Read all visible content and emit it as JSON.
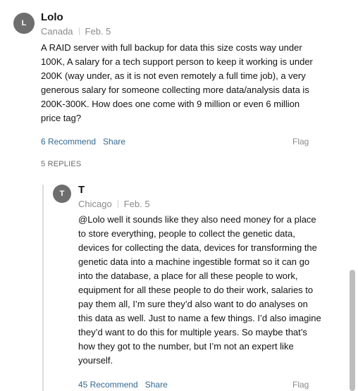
{
  "comment": {
    "avatar_letter": "L",
    "author": "Lolo",
    "location": "Canada",
    "date": "Feb. 5",
    "text": "A RAID server with full backup for data this size costs way under 100K, A salary for a tech support person to keep it working is under 200K (way under, as it is not even remotely a full time job), a very generous salary for someone collecting more data/analysis data is 200K-300K.  How does one come with 9 million or even 6 million price tag?",
    "recommend_label": "6 Recommend",
    "share_label": "Share",
    "flag_label": "Flag",
    "replies_label": "5 REPLIES"
  },
  "reply": {
    "avatar_letter": "T",
    "author": "T",
    "location": "Chicago",
    "date": "Feb. 5",
    "text": "@Lolo well it sounds like they also need money for a place to store everything, people to collect the genetic data, devices for collecting the data, devices for transforming the genetic data into a machine ingestible format so it can go into the database, a place for all these people to work, equipment for all these people to do their work, salaries to pay them all, I’m sure they’d also want to do analyses on this data as well. Just to name a few things. I’d also imagine they’d want to do this for multiple years. So maybe that’s how they got to the number, but I’m not an expert like yourself.",
    "recommend_label": "45 Recommend",
    "share_label": "Share",
    "flag_label": "Flag"
  },
  "colors": {
    "link": "#326891",
    "muted": "#8a8a8a",
    "avatar": "#6e6e6e"
  }
}
